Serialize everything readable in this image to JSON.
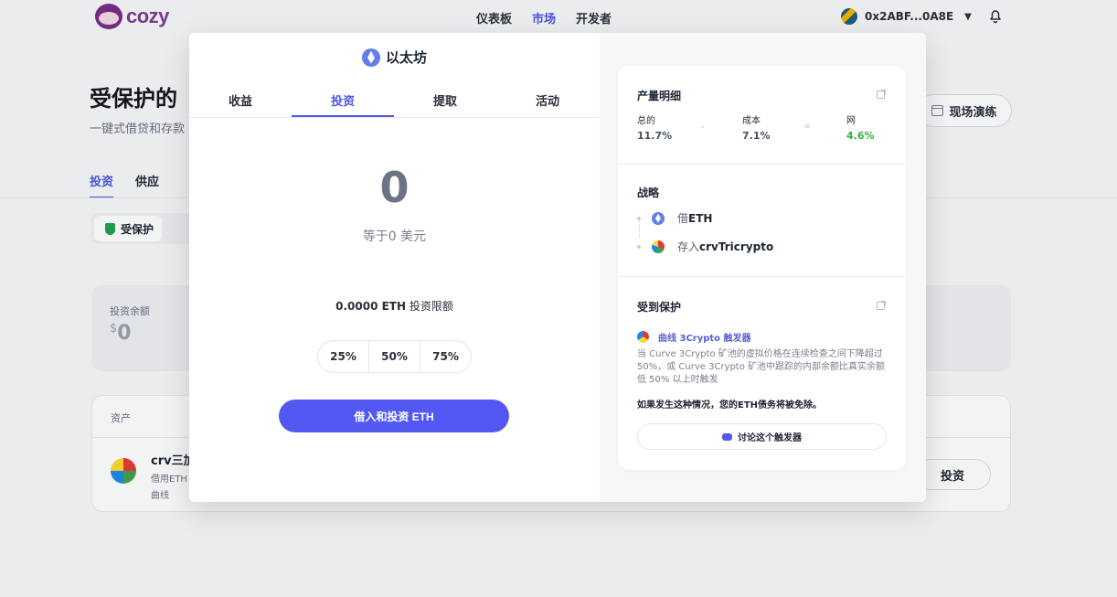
{
  "brand": {
    "name": "cozy"
  },
  "nav": {
    "items": [
      "仪表板",
      "市场",
      "开发者"
    ],
    "active_index": 1
  },
  "wallet": {
    "address": "0x2ABF...0A8E"
  },
  "page": {
    "title": "受保护的",
    "subtitle": "一键式借贷和存款",
    "simulate_label": "现场演练",
    "tabs": [
      "投资",
      "供应"
    ],
    "filter_chip": "受保护",
    "balance_label": "投资余额",
    "balance_currency": "$",
    "balance_value": "0",
    "asset_header": "资产",
    "asset_name": "crv三加",
    "asset_desc": "借用ETH",
    "asset_curve": "曲线",
    "invest_button": "投资"
  },
  "modal": {
    "asset": "以太坊",
    "tabs": [
      "收益",
      "投资",
      "提取",
      "活动"
    ],
    "active_tab": 1,
    "amount": "0",
    "amount_usd": "等于0 美元",
    "limit_value": "0.0000 ETH",
    "limit_label": "投资限额",
    "percent_options": [
      "25%",
      "50%",
      "75%"
    ],
    "primary_button": "借入和投资 ETH",
    "yield": {
      "title": "产量明细",
      "total_label": "总的",
      "total_value": "11.7%",
      "minus": "-",
      "cost_label": "成本",
      "cost_value": "7.1%",
      "equals": "=",
      "net_label": "网",
      "net_value": "4.6%"
    },
    "strategy": {
      "title": "战略",
      "step1_prefix": "借",
      "step1_token": "ETH",
      "step2_prefix": "存入",
      "step2_token": "crvTricrypto"
    },
    "protection": {
      "title": "受到保护",
      "trigger_name": "曲线 3Crypto 触发器",
      "trigger_desc": "当 Curve 3Crypto 矿池的虚拟价格在连续检查之间下降超过 50%，或 Curve 3Crypto 矿池中跟踪的内部余额比真实余额低 50% 以上时触发",
      "warning": "如果发生这种情况，您的ETH债务将被免除。",
      "discuss_button": "讨论这个触发器"
    }
  },
  "colors": {
    "accent": "#4b57e0",
    "primary_button": "#5458f2",
    "net_positive": "#2fb53d"
  }
}
